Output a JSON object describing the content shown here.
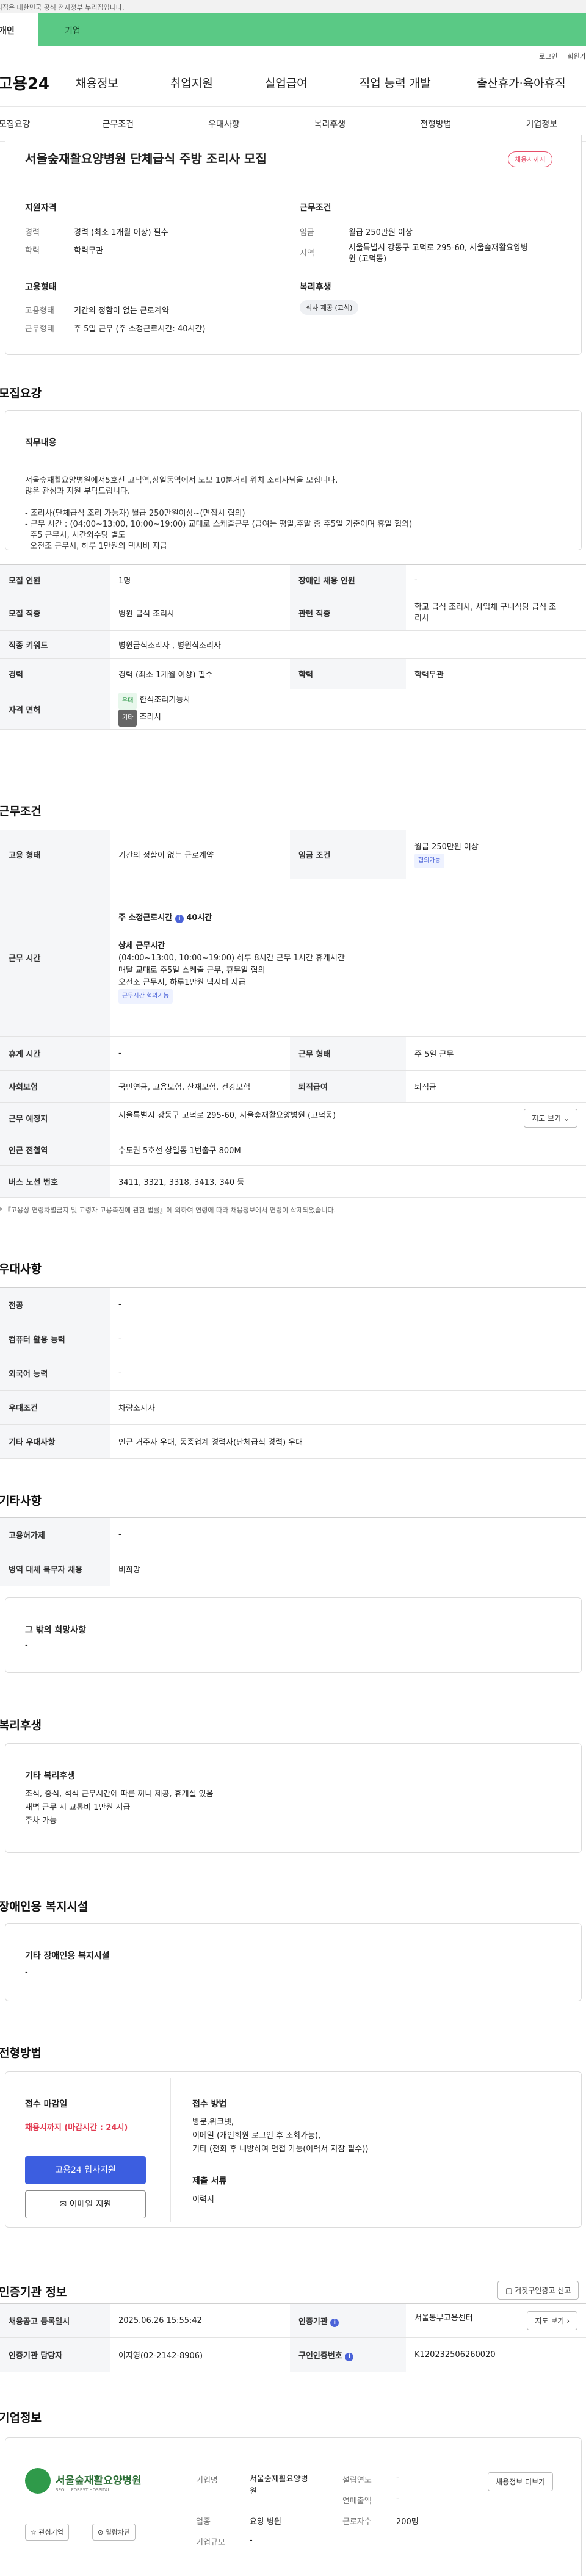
{
  "gov_banner": "이 누리집은 대한민국 공식 전자정부 누리집입니다.",
  "tabs": [
    "개인",
    "기업"
  ],
  "util": [
    "로그인",
    "회원가입"
  ],
  "logo": "고용24",
  "main_nav": [
    "채용정보",
    "취업지원",
    "실업급여",
    "직업 능력 개발",
    "출산휴가·육아휴직"
  ],
  "sub_nav": [
    "모집요강",
    "근무조건",
    "우대사항",
    "복리후생",
    "전형방법",
    "기업정보"
  ],
  "header": {
    "title": "서울숲재활요양병원 단체급식 주방 조리사 모집",
    "badge": "채용시까지",
    "qual_title": "지원자격",
    "career_k": "경력",
    "career_v": "경력 (최소 1개월 이상) 필수",
    "edu_k": "학력",
    "edu_v": "학력무관",
    "emp_title": "고용형태",
    "emptype_k": "고용형태",
    "emptype_v": "기간의 정함이 없는 근로계약",
    "work_k": "근무형태",
    "work_v": "주 5일 근무 (주 소정근로시간: 40시간)",
    "cond_title": "근무조건",
    "wage_k": "임금",
    "wage_v": "월급 250만원 이상",
    "loc_k": "지역",
    "loc_v1": "서울특별시 강동구 고덕로 295-60, 서울숲재활요양병",
    "loc_v2": "원 (고덕동)",
    "welfare_title": "복리후생",
    "welfare_chip": "식사 제공 (교식)"
  },
  "recruit": {
    "title": "모집요강",
    "job_title": "직무내용",
    "lines": [
      "서울숲재활요양병원에서5호선 고덕역,상일동역에서 도보 10분거리 위치 조리사님을 모십니다.",
      "많은 관심과 지원 부탁드립니다.",
      "",
      "- 조리사(단체급식 조리 가능자) 월급 250만원이상~(면접시 협의)",
      "- 근무 시간 : (04:00~13:00, 10:00~19:00) 교대로 스케줄근무 (급여는 평일,주말 중 주5일 기준이며 휴일 협의)",
      "  주5 근무시, 시간외수당 별도",
      "  오전조 근무시, 하루 1만원의 택시비 지급"
    ],
    "rows": {
      "r1k": "모집 인원",
      "r1v": "1명",
      "r1k2": "장애인 채용 인원",
      "r1v2": "-",
      "r2k": "모집 직종",
      "r2v": "병원 급식 조리사",
      "r2k2": "관련 직종",
      "r2v2a": "학교 급식 조리사, 사업체 구내식당 급식 조",
      "r2v2b": "리사",
      "r3k": "직종 키워드",
      "r3v": "병원급식조리사 , 병원식조리사",
      "r4k": "경력",
      "r4v": "경력 (최소 1개월 이상) 필수",
      "r4k2": "학력",
      "r4v2": "학력무관",
      "r5k": "자격 면허",
      "r5c1": "우대",
      "r5v1": "한식조리기능사",
      "r5c2": "기타",
      "r5v2": "조리사"
    }
  },
  "cond": {
    "title": "근무조건",
    "emp_k": "고용 형태",
    "emp_v": "기간의 정함이 없는 근로계약",
    "wage_k": "임금 조건",
    "wage_v": "월급 250만원 이상",
    "wage_chip": "협의가능",
    "time_k": "근무 시간",
    "week": "주 소정근로시간",
    "week_v": "40시간",
    "detail_t": "상세 근무시간",
    "detail": [
      "(04:00~13:00, 10:00~19:00) 하루 8시간 근무 1시간 휴게시간",
      "매달 교대로 주5일 스케줄 근무, 휴무일 협의",
      "오전조 근무시, 하루1만원 택시비 지급"
    ],
    "time_chip": "근무시간 협의가능",
    "rest_k": "휴게 시간",
    "rest_v": "-",
    "form_k": "근무 형태",
    "form_v": "주 5일 근무",
    "ins_k": "사회보험",
    "ins_v": "국민연금, 고용보험, 산재보험, 건강보험",
    "ret_k": "퇴직급여",
    "ret_v": "퇴직금",
    "place_k": "근무 예정지",
    "place_v": "서울특별시 강동구 고덕로 295-60, 서울숲재활요양병원 (고덕동)",
    "map_btn": "지도 보기",
    "subway_k": "인근 전철역",
    "subway_v": "수도권 5호선 상일동 1번출구 800M",
    "bus_k": "버스 노선 번호",
    "bus_v": "3411, 3321, 3318, 3413, 340 등",
    "note": "* 『고용상 연령차별금지 및 고령자 고용촉진에 관한 법률』에 의하여 연령에 따라 채용정보에서 연령이 삭제되었습니다."
  },
  "pref": {
    "title": "우대사항",
    "rows": [
      [
        "전공",
        "-"
      ],
      [
        "컴퓨터 활용 능력",
        "-"
      ],
      [
        "외국어 능력",
        "-"
      ],
      [
        "우대조건",
        "차량소지자"
      ],
      [
        "기타 우대사항",
        "인근 거주자 우대, 동종업계 경력자(단체급식 경력) 우대"
      ]
    ]
  },
  "etc": {
    "title": "기타사항",
    "rows": [
      [
        "고용허가제",
        "-"
      ],
      [
        "병역 대체 복무자 채용",
        "비희망"
      ]
    ],
    "box_t": "그 밖의 희망사항",
    "box_v": "-"
  },
  "welfare": {
    "title": "복리후생",
    "box_t": "기타 복리후생",
    "lines": [
      "조식, 중식, 석식 근무시간에 따른 끼니 제공, 휴게실 있음",
      "새벽 근무 시 교통비 1만원 지급",
      "주차 가능"
    ]
  },
  "disabled": {
    "title": "장애인용 복지시설",
    "box_t": "기타 장애인용 복지시설",
    "box_v": "-"
  },
  "select": {
    "title": "전형방법",
    "deadline_t": "접수 마감일",
    "deadline_v": "채용시까지 (마감시간 : 24시)",
    "apply_btn": "고용24 입사지원",
    "email_btn": "이메일 지원",
    "method_t": "접수 방법",
    "method": [
      "방문,워크넷,",
      "이메일 (개인회원 로그인 후 조회가능),",
      "기타 (전화 후 내방하여 면접 가능(이력서 지참 필수))"
    ],
    "docs_t": "제출 서류",
    "docs_v": "이력서"
  },
  "auth": {
    "title": "인증기관 정보",
    "report_btn": "거짓구인광고 신고",
    "r1k": "채용공고 등록일시",
    "r1v": "2025.06.26 15:55:42",
    "r1k2": "인증기관",
    "r1v2": "서울동부고용센터",
    "map_btn": "지도 보기",
    "r2k": "인증기관 담당자",
    "r2v": "이지영(02-2142-8906)",
    "r2k2": "구인인증번호",
    "r2v2": "K120232506260020"
  },
  "company": {
    "title": "기업정보",
    "logo_text": "서울숲재활요양병원",
    "logo_sub": "SEOUL FOREST HOSPITAL",
    "fav_btn": "관심기업",
    "block_btn": "열람차단",
    "name_k": "기업명",
    "name_v1": "서울숲재활요양병",
    "name_v2": "원",
    "est_k": "설립연도",
    "est_v": "-",
    "sales_k": "연매출액",
    "sales_v": "-",
    "ind_k": "업종",
    "ind_v": "요양 병원",
    "emp_k": "근로자수",
    "emp_v": "200명",
    "size_k": "기업규모",
    "size_v": "-",
    "more_btn": "채용정보 더보기"
  }
}
